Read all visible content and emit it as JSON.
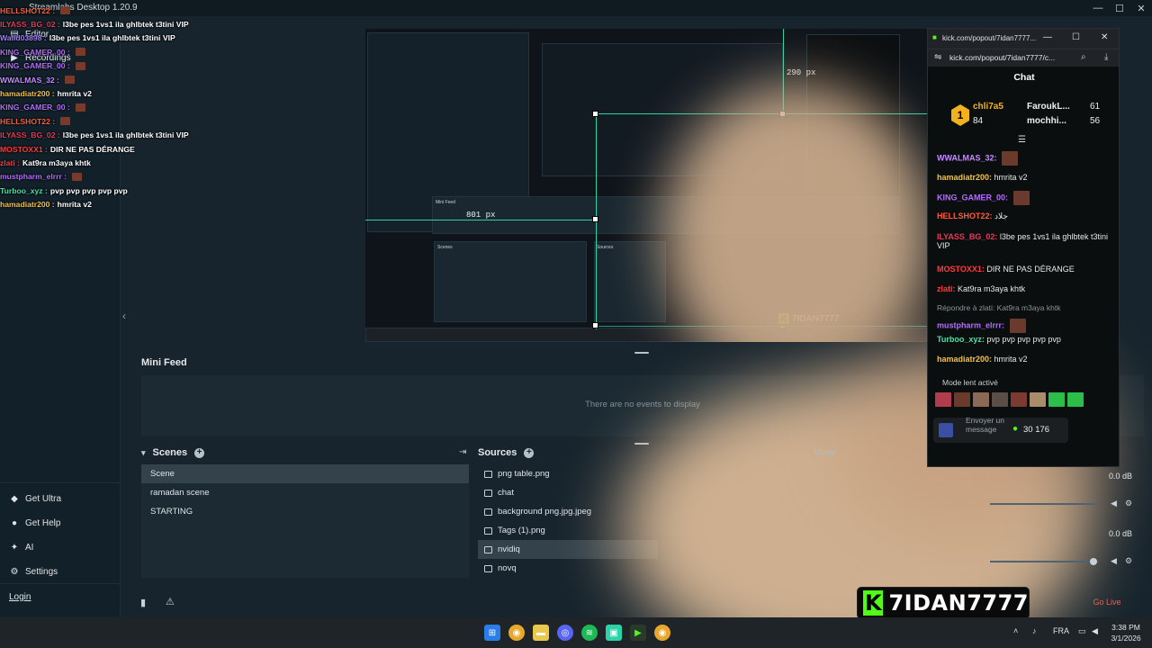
{
  "app": {
    "title": "Streamlabs Desktop 1.20.9",
    "window_controls": [
      "—",
      "☐",
      "✕"
    ]
  },
  "sidebar": {
    "top_items": [
      {
        "label": "Editor",
        "icon": "editor-icon"
      },
      {
        "label": "Recordings",
        "icon": "recordings-icon"
      }
    ],
    "bottom_items": [
      {
        "label": "Get Ultra",
        "icon": "ultra-icon"
      },
      {
        "label": "Get Help",
        "icon": "help-icon"
      },
      {
        "label": "AI",
        "icon": "ai-icon"
      },
      {
        "label": "Settings",
        "icon": "gear-icon"
      }
    ],
    "login": "Login"
  },
  "overlay_chat": [
    {
      "user": "HELLSHOT22 :",
      "color": "#ff5b3a",
      "msg": "",
      "emote": true
    },
    {
      "user": "ILYASS_BG_02 :",
      "color": "#e23b58",
      "msg": "l3be pes 1vs1 ila ghlbtek t3tini VIP",
      "emote": false
    },
    {
      "user": "Walid03898 :",
      "color": "#a07cff",
      "msg": "l3be pes 1vs1 ila ghlbtek t3tini VIP",
      "emote": false
    },
    {
      "user": "KING_GAMER_00 :",
      "color": "#b56bff",
      "msg": "",
      "emote": true
    },
    {
      "user": "KING_GAMER_00 :",
      "color": "#b56bff",
      "msg": "",
      "emote": true
    },
    {
      "user": "WWALMAS_32 :",
      "color": "#c58bff",
      "msg": "",
      "emote": true
    },
    {
      "user": "hamadiatr200 :",
      "color": "#f0c24d",
      "msg": "hmrita v2",
      "emote": false
    },
    {
      "user": "KING_GAMER_00 :",
      "color": "#b56bff",
      "msg": "",
      "emote": true
    },
    {
      "user": "HELLSHOT22 :",
      "color": "#ff5b3a",
      "msg": "",
      "emote": true
    },
    {
      "user": "ILYASS_BG_02 :",
      "color": "#e23b58",
      "msg": "l3be pes 1vs1 ila ghlbtek t3tini VIP",
      "emote": false
    },
    {
      "user": "MOSTOXX1 :",
      "color": "#ff3b3b",
      "msg": "DIR NE PAS DÉRANGE",
      "emote": false
    },
    {
      "user": "zlati :",
      "color": "#ff3b3b",
      "msg": "Kat9ra m3aya khtk",
      "emote": false
    },
    {
      "user": "mustpharm_elrrr :",
      "color": "#b56bff",
      "msg": "",
      "emote": true
    },
    {
      "user": "Turboo_xyz :",
      "color": "#4ee0a6",
      "msg": "pvp pvp pvp pvp pvp",
      "emote": false
    },
    {
      "user": "hamadiatr200 :",
      "color": "#f0c24d",
      "msg": "hmrita v2",
      "emote": false
    }
  ],
  "preview": {
    "measure_h": "801 px",
    "measure_v": "290 px",
    "nested_feed": "Mini Feed",
    "nested_scenes": "Scenes",
    "nested_sources": "Sources"
  },
  "mini_feed": {
    "title": "Mini Feed",
    "empty": "There are no events to display"
  },
  "scenes": {
    "title": "Scenes",
    "items": [
      "Scene",
      "ramadan scene",
      "STARTING"
    ],
    "active_index": 0
  },
  "sources": {
    "title": "Sources",
    "items": [
      "png table.png",
      "chat",
      "background png.jpg.jpeg",
      "Tags (1).png",
      "nvidiq",
      "novq"
    ],
    "active_index": 4
  },
  "mixer": {
    "title": "Mixer",
    "levels": [
      "0.0 dB",
      "0.0 dB"
    ]
  },
  "stream_button": "Go Live",
  "kick": {
    "tab_title": "kick.com/popout/7idan7777...",
    "url": "kick.com/popout/7idan7777/c...",
    "chat_title": "Chat",
    "leaders": [
      {
        "name": "chli7a5",
        "value": "84"
      },
      {
        "name": "FaroukL...",
        "value": "61"
      },
      {
        "name": "mochhi...",
        "value": "56"
      }
    ],
    "rank": "1",
    "lines": [
      {
        "user": "WWALMAS_32:",
        "color": "#c58bff",
        "msg": "",
        "emote": true
      },
      {
        "user": "hamadiatr200:",
        "color": "#f0c24d",
        "msg": "hmrita v2",
        "emote": false
      },
      {
        "user": "KING_GAMER_00:",
        "color": "#b56bff",
        "msg": "",
        "emote": true
      },
      {
        "user": "HELLSHOT22:",
        "color": "#ff5b3a",
        "msg": "جلاد",
        "emote": false
      },
      {
        "user": "ILYASS_BG_02:",
        "color": "#e23b58",
        "msg": "l3be pes 1vs1 ila ghlbtek t3tini VIP",
        "emote": false
      },
      {
        "user": "MOSTOXX1:",
        "color": "#ff3b3b",
        "msg": "DIR NE PAS DÉRANGE",
        "emote": false
      },
      {
        "user": "zlati:",
        "color": "#ff3b3b",
        "msg": "Kat9ra m3aya khtk",
        "emote": false
      },
      {
        "user": "mustpharm_elrrr:",
        "color": "#b56bff",
        "msg": "",
        "emote": true
      },
      {
        "user": "Turboo_xyz:",
        "color": "#4ee0a6",
        "msg": "pvp pvp pvp pvp pvp",
        "emote": false
      },
      {
        "user": "hamadiatr200:",
        "color": "#f0c24d",
        "msg": "hmrita v2",
        "emote": false
      }
    ],
    "reply_hint": "Répondre à zlati: Kat9ra m3aya khtk",
    "slow_mode": "Mode lent activé",
    "send_placeholder": "Envoyer un message",
    "points": "30 176"
  },
  "kick_logo": {
    "letter": "K",
    "name": "7IDAN7777"
  },
  "taskbar": {
    "lang": "FRA",
    "time": "3:38 PM",
    "date": "3/1/2026"
  },
  "colors": {
    "accent": "#2bd3a6",
    "kick_green": "#53fc18",
    "bg": "#17242d"
  }
}
